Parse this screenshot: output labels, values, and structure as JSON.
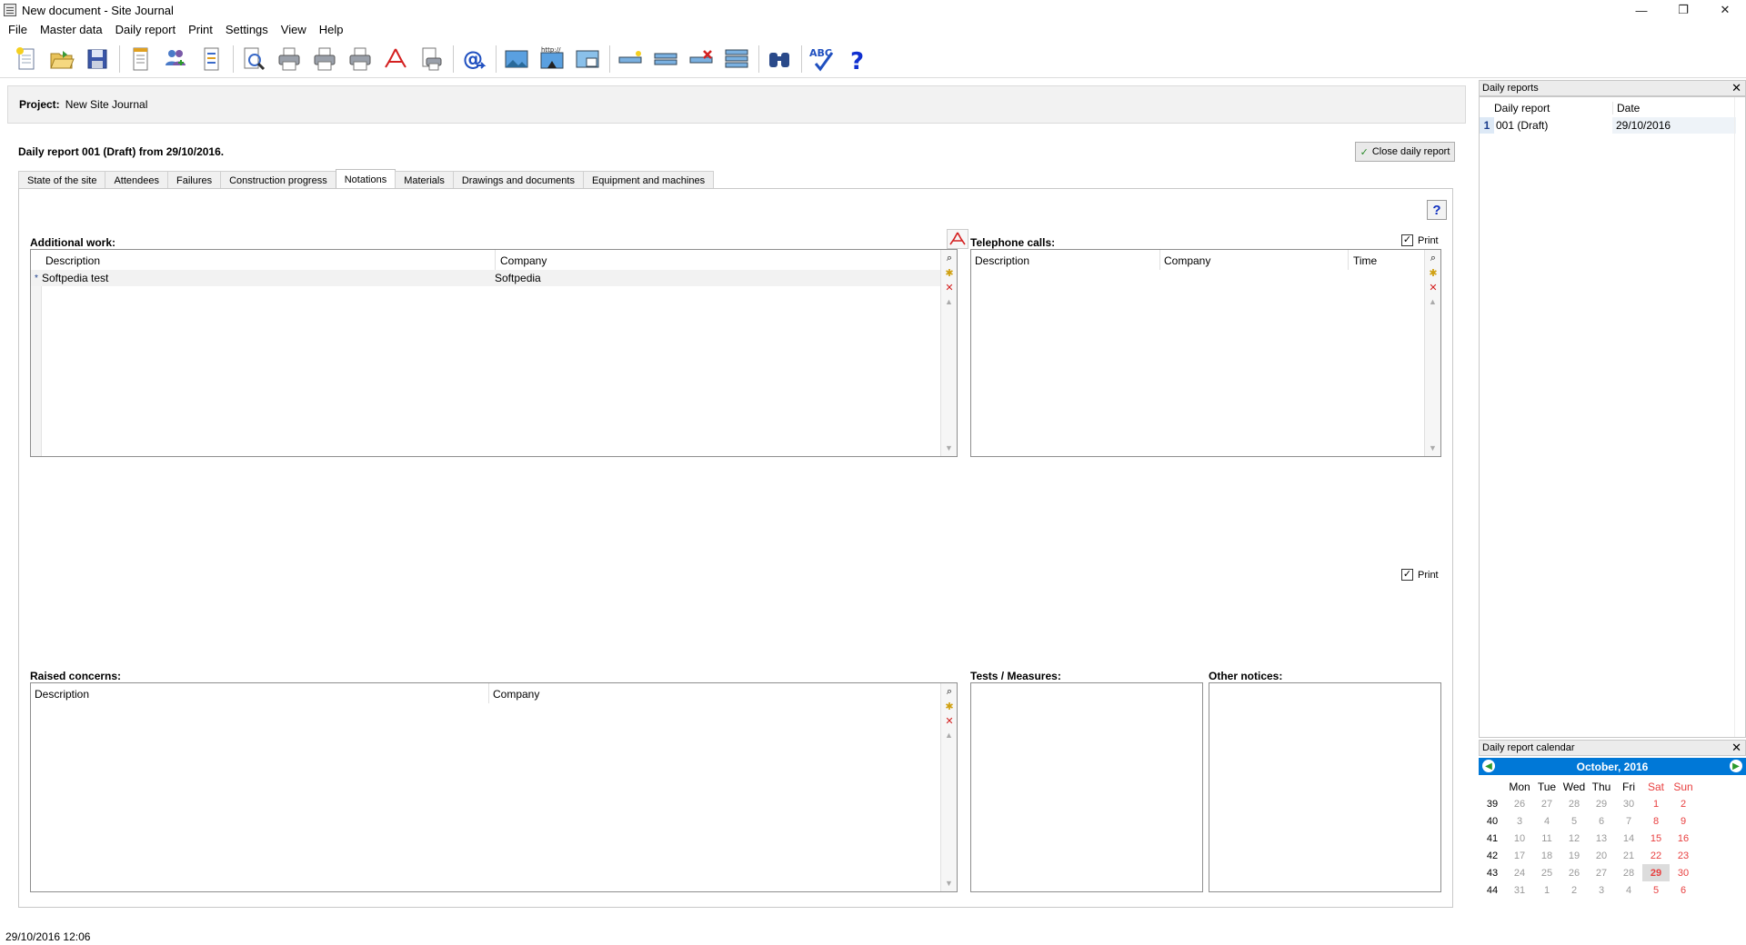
{
  "window": {
    "title": "New document - Site Journal",
    "controls": [
      "—",
      "❐",
      "✕"
    ]
  },
  "menu": [
    "File",
    "Master data",
    "Daily report",
    "Print",
    "Settings",
    "View",
    "Help"
  ],
  "toolbar": {
    "icons": [
      "new-document-icon",
      "open-folder-icon",
      "save-icon",
      "report-icon",
      "users-icon",
      "list-icon",
      "preview-icon",
      "print-icon",
      "print-icon",
      "print-icon",
      "pdf-icon",
      "print-setup-icon",
      "email-icon",
      "image-icon",
      "web-icon",
      "image-export-icon",
      "add-row-icon",
      "edit-row-icon",
      "delete-row-icon",
      "move-row-icon",
      "binoculars-icon",
      "spellcheck-icon",
      "help-icon"
    ],
    "spellcheck_label": "ABC",
    "help_label": "?"
  },
  "project": {
    "label": "Project:",
    "value": "New Site Journal"
  },
  "report_heading": "Daily report 001 (Draft) from 29/10/2016.",
  "close_report_label": "Close daily report",
  "tabs": [
    "State of the site",
    "Attendees",
    "Failures",
    "Construction progress",
    "Notations",
    "Materials",
    "Drawings and documents",
    "Equipment and machines"
  ],
  "active_tab": "Notations",
  "help_button": "?",
  "additional_work": {
    "label": "Additional work:",
    "columns": [
      "Description",
      "Company"
    ],
    "rows": [
      {
        "marker": "*",
        "description": "Softpedia test",
        "company": "Softpedia"
      }
    ]
  },
  "telephone_calls": {
    "label": "Telephone calls:",
    "print_label": "Print",
    "print_checked": true,
    "columns": [
      "Description",
      "Company",
      "Time"
    ]
  },
  "print_middle": {
    "label": "Print",
    "checked": true
  },
  "raised_concerns": {
    "label": "Raised concerns:",
    "columns": [
      "Description",
      "Company"
    ]
  },
  "tests_measures": {
    "label": "Tests / Measures:"
  },
  "other_notices": {
    "label": "Other notices:"
  },
  "status_datetime": "29/10/2016 12:06",
  "daily_reports_panel": {
    "title": "Daily reports",
    "columns": [
      "Daily report",
      "Date"
    ],
    "rows": [
      {
        "num": "1",
        "report": "001 (Draft)",
        "date": "29/10/2016"
      }
    ]
  },
  "calendar": {
    "title": "Daily report calendar",
    "month_label": "October, 2016",
    "weekdays": [
      "Mon",
      "Tue",
      "Wed",
      "Thu",
      "Fri",
      "Sat",
      "Sun"
    ],
    "weeks": [
      {
        "week": "39",
        "days": [
          "26",
          "27",
          "28",
          "29",
          "30",
          "1",
          "2"
        ]
      },
      {
        "week": "40",
        "days": [
          "3",
          "4",
          "5",
          "6",
          "7",
          "8",
          "9"
        ]
      },
      {
        "week": "41",
        "days": [
          "10",
          "11",
          "12",
          "13",
          "14",
          "15",
          "16"
        ]
      },
      {
        "week": "42",
        "days": [
          "17",
          "18",
          "19",
          "20",
          "21",
          "22",
          "23"
        ]
      },
      {
        "week": "43",
        "days": [
          "24",
          "25",
          "26",
          "27",
          "28",
          "29",
          "30"
        ]
      },
      {
        "week": "44",
        "days": [
          "31",
          "1",
          "2",
          "3",
          "4",
          "5",
          "6"
        ]
      }
    ],
    "selected_day": "29",
    "weekend_color": "#e84040",
    "header_color": "#0078d7"
  }
}
